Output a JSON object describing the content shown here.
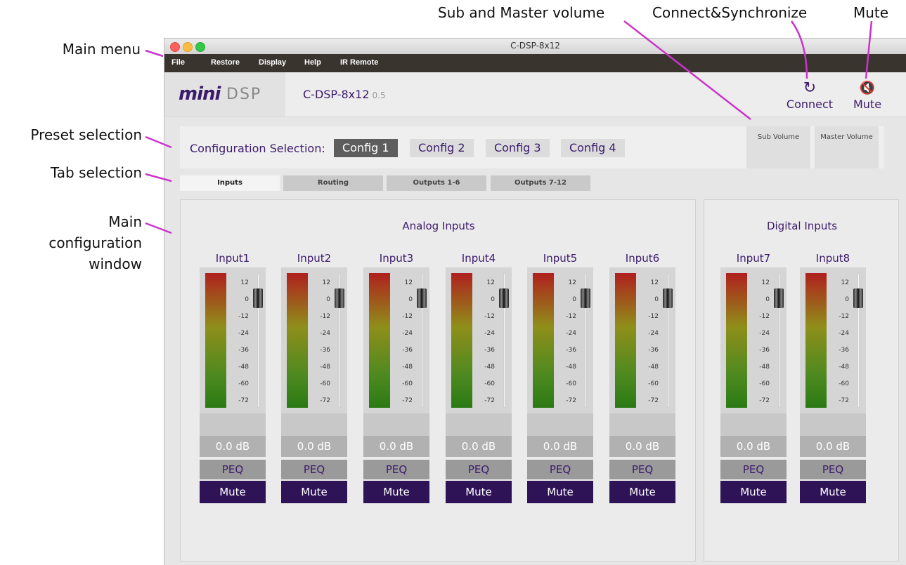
{
  "annotations": {
    "main_menu": "Main menu",
    "preset_selection": "Preset selection",
    "tab_selection": "Tab selection",
    "main_config_line1": "Main",
    "main_config_line2": "configuration",
    "main_config_line3": "window",
    "sub_master": "Sub and Master volume",
    "connect_sync": "Connect&Synchronize",
    "mute": "Mute"
  },
  "window": {
    "title": "C-DSP-8x12"
  },
  "menu": [
    "File",
    "Restore",
    "Display",
    "Help",
    "IR Remote"
  ],
  "header": {
    "logo_left": "mini",
    "logo_right": "DSP",
    "device_name": "C-DSP-8x12",
    "version": "0.5",
    "connect_label": "Connect",
    "connect_icon": "↻",
    "mute_label": "Mute",
    "mute_icon": "🔇"
  },
  "preset": {
    "label": "Configuration Selection:",
    "configs": [
      "Config 1",
      "Config 2",
      "Config 3",
      "Config 4"
    ],
    "active": "Config 1",
    "sub_volume": "Sub Volume",
    "master_volume": "Master Volume"
  },
  "tabs": [
    "Inputs",
    "Routing",
    "Outputs 1-6",
    "Outputs 7-12"
  ],
  "active_tab": "Inputs",
  "panels": {
    "analog": "Analog Inputs",
    "digital": "Digital Inputs"
  },
  "scale_ticks": [
    "12",
    "0",
    "-12",
    "-24",
    "-36",
    "-48",
    "-60",
    "-72"
  ],
  "channels": [
    {
      "name": "Input1",
      "gain": "0.0 dB",
      "peq": "PEQ",
      "mute": "Mute"
    },
    {
      "name": "Input2",
      "gain": "0.0 dB",
      "peq": "PEQ",
      "mute": "Mute"
    },
    {
      "name": "Input3",
      "gain": "0.0 dB",
      "peq": "PEQ",
      "mute": "Mute"
    },
    {
      "name": "Input4",
      "gain": "0.0 dB",
      "peq": "PEQ",
      "mute": "Mute"
    },
    {
      "name": "Input5",
      "gain": "0.0 dB",
      "peq": "PEQ",
      "mute": "Mute"
    },
    {
      "name": "Input6",
      "gain": "0.0 dB",
      "peq": "PEQ",
      "mute": "Mute"
    },
    {
      "name": "Input7",
      "gain": "0.0 dB",
      "peq": "PEQ",
      "mute": "Mute"
    },
    {
      "name": "Input8",
      "gain": "0.0 dB",
      "peq": "PEQ",
      "mute": "Mute"
    }
  ],
  "colors": {
    "accent": "#3b1a6b",
    "mute_bg": "#2e1357",
    "callout_line": "#cc33cc"
  }
}
